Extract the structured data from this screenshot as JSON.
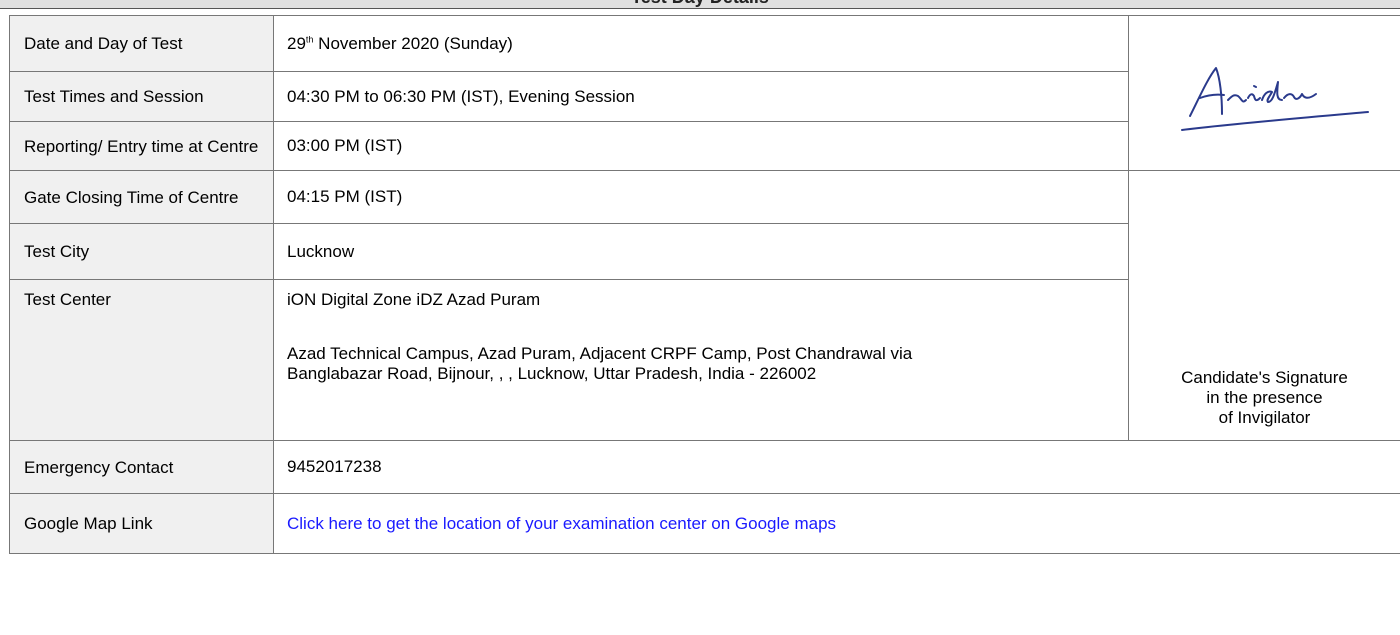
{
  "header": {
    "title": "Test Day Details"
  },
  "rows": {
    "date": {
      "label": "Date and Day of Test",
      "day_num": "29",
      "day_suffix": "th",
      "rest": " November 2020 (Sunday)"
    },
    "times": {
      "label": "Test Times and Session",
      "value": "04:30 PM to 06:30 PM (IST), Evening Session"
    },
    "reporting": {
      "label": "Reporting/ Entry time at Centre",
      "value": "03:00 PM (IST)"
    },
    "gate": {
      "label": "Gate Closing Time of Centre",
      "value": "04:15 PM (IST)"
    },
    "city": {
      "label": "Test City",
      "value": "Lucknow"
    },
    "center": {
      "label": "Test Center",
      "name": "iON Digital Zone iDZ  Azad Puram",
      "address_line1": "Azad Technical Campus, Azad Puram, Adjacent CRPF Camp, Post Chandrawal via",
      "address_line2": "Banglabazar Road, Bijnour, , , Lucknow, Uttar Pradesh, India - 226002"
    },
    "emergency": {
      "label": "Emergency Contact",
      "value": "9452017238"
    },
    "map": {
      "label": "Google Map Link",
      "link_text": "Click here to get the location of your examination center on Google maps",
      "link_color": "#1a1aff"
    }
  },
  "signature": {
    "candidate_line1": "Candidate's Signature",
    "candidate_line2": "in the presence",
    "candidate_line3": "of Invigilator"
  }
}
